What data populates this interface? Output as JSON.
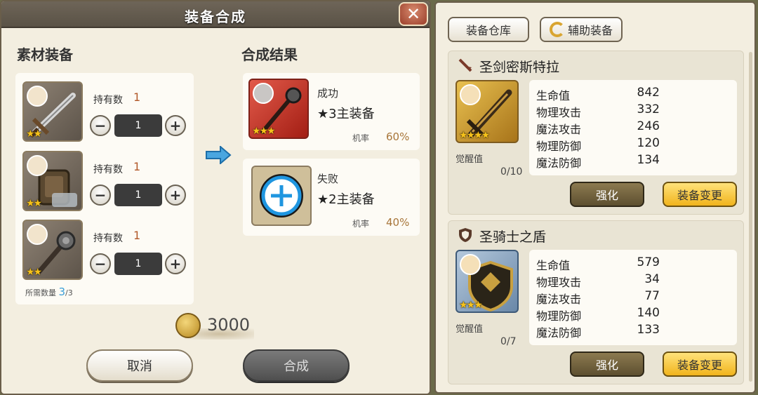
{
  "dialog": {
    "title": "装备合成",
    "close_label": "✕",
    "materials_title": "素材装备",
    "results_title": "合成结果",
    "materials": [
      {
        "icon": "sword-icon",
        "stars": "★★",
        "holding_label": "持有数",
        "holding_value": "1",
        "quantity": "1"
      },
      {
        "icon": "shield-icon",
        "stars": "★★",
        "holding_label": "持有数",
        "holding_value": "1",
        "quantity": "1"
      },
      {
        "icon": "mace-icon",
        "stars": "★★",
        "holding_label": "持有数",
        "holding_value": "1",
        "quantity": "1"
      }
    ],
    "stepper": {
      "minus": "−",
      "plus": "+"
    },
    "required_label": "所需数量",
    "required_count": "3",
    "required_total": "/3",
    "results": [
      {
        "icon": "mace-icon",
        "stars": "★★★",
        "status": "成功",
        "name": "★3主装备",
        "rate_label": "机率",
        "rate": "60%"
      },
      {
        "icon": "plus-circle-icon",
        "status": "失败",
        "name": "★2主装备",
        "rate_label": "机率",
        "rate": "40%"
      }
    ],
    "cost": "3000",
    "cancel_label": "取消",
    "synthesize_label": "合成"
  },
  "right_panel": {
    "warehouse_label": "装备仓库",
    "auxiliary_label": "辅助装备",
    "equipment": [
      {
        "name": "圣剑密斯特拉",
        "type_icon": "sword-type-icon",
        "icon": "sword-icon",
        "stars": "★★★★",
        "awaken_label": "觉醒值",
        "awaken_value": "0/10",
        "stats": [
          {
            "label": "生命值",
            "value": "842"
          },
          {
            "label": "物理攻击",
            "value": "332"
          },
          {
            "label": "魔法攻击",
            "value": "246"
          },
          {
            "label": "物理防御",
            "value": "120"
          },
          {
            "label": "魔法防御",
            "value": "134"
          }
        ],
        "enhance_label": "强化",
        "change_label": "装备变更"
      },
      {
        "name": "圣骑士之盾",
        "type_icon": "shield-type-icon",
        "icon": "shield-icon",
        "stars": "★★★",
        "awaken_label": "觉醒值",
        "awaken_value": "0/7",
        "stats": [
          {
            "label": "生命值",
            "value": "579"
          },
          {
            "label": "物理攻击",
            "value": "34"
          },
          {
            "label": "魔法攻击",
            "value": "77"
          },
          {
            "label": "物理防御",
            "value": "140"
          },
          {
            "label": "魔法防御",
            "value": "133"
          }
        ],
        "enhance_label": "强化",
        "change_label": "装备变更"
      }
    ]
  },
  "colors": {
    "accent_gold": "#f1b41d",
    "rate_text": "#a8763a",
    "holding_text": "#b2592a",
    "required_count": "#3a9ed8"
  }
}
